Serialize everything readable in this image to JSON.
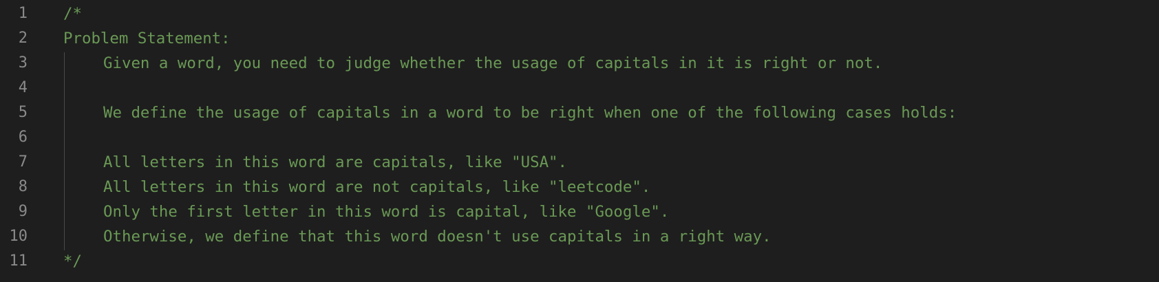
{
  "editor": {
    "lines": [
      {
        "number": "1",
        "text": "/*"
      },
      {
        "number": "2",
        "text": "Problem Statement:"
      },
      {
        "number": "3",
        "text": "Given a word, you need to judge whether the usage of capitals in it is right or not."
      },
      {
        "number": "4",
        "text": ""
      },
      {
        "number": "5",
        "text": "We define the usage of capitals in a word to be right when one of the following cases holds:"
      },
      {
        "number": "6",
        "text": ""
      },
      {
        "number": "7",
        "text": "All letters in this word are capitals, like \"USA\"."
      },
      {
        "number": "8",
        "text": "All letters in this word are not capitals, like \"leetcode\"."
      },
      {
        "number": "9",
        "text": "Only the first letter in this word is capital, like \"Google\"."
      },
      {
        "number": "10",
        "text": "Otherwise, we define that this word doesn't use capitals in a right way."
      },
      {
        "number": "11",
        "text": "*/"
      }
    ]
  },
  "colors": {
    "background": "#1e1e1e",
    "comment": "#6a9955",
    "line_number": "#8a8a8a"
  }
}
